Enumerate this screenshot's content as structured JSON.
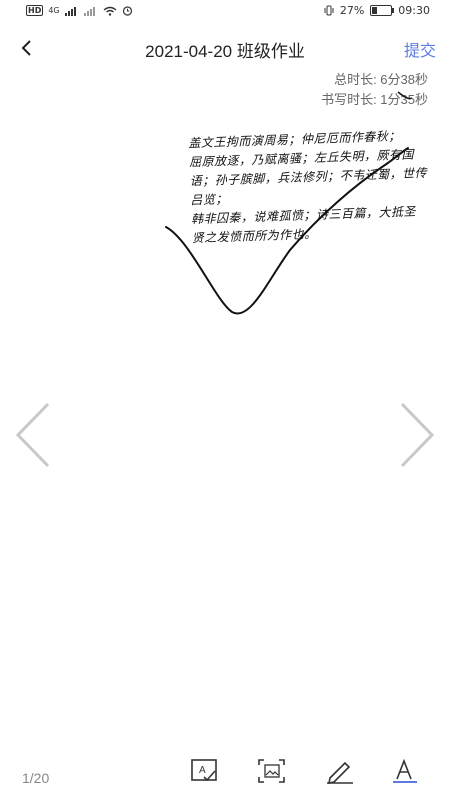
{
  "status_bar": {
    "hd_badge": "HD",
    "network_label": "4G",
    "battery_text": "27%",
    "battery_level": 0.27,
    "time": "09:30"
  },
  "header": {
    "title": "2021-04-20 班级作业",
    "submit_label": "提交"
  },
  "durations": {
    "total": "总时长: 6分38秒",
    "writing": "书写时长: 1分35秒"
  },
  "handwriting": {
    "lines": [
      "盖文王拘而演周易；仲尼厄而作春秋；",
      "屈原放逐，乃赋离骚；左丘失明，厥有国",
      "语；孙子膑脚，兵法修列；不韦迁蜀，世传吕览；",
      "韩非囚秦，说难孤愤；诗三百篇，大抵圣",
      "贤之发愤而所为作也。"
    ]
  },
  "footer": {
    "page_indicator": "1/20"
  },
  "icons": {
    "back": "chevron-left-icon",
    "prev": "chevron-left-large-icon",
    "next": "chevron-right-large-icon",
    "tools": [
      "text-recognize-icon",
      "image-scan-icon",
      "pen-icon",
      "text-style-icon"
    ]
  },
  "colors": {
    "accent": "#5b7be0",
    "text_underline": "#5b7be0"
  }
}
